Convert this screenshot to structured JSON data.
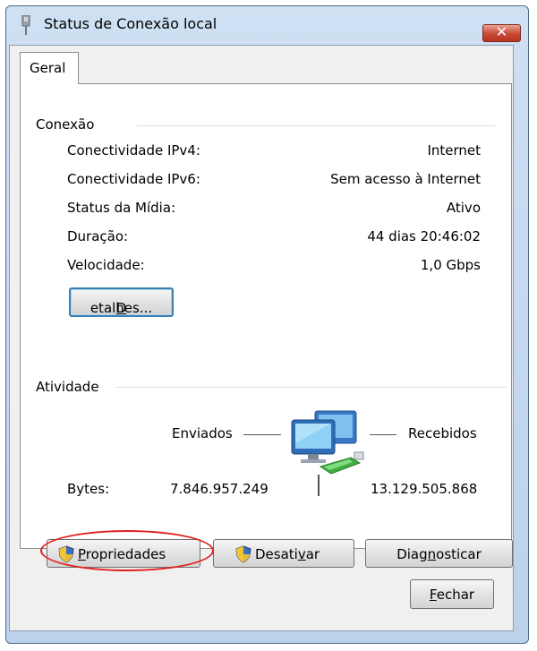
{
  "window": {
    "title": "Status de Conexão local",
    "close_label": "✕"
  },
  "tab": {
    "label": "Geral"
  },
  "connection": {
    "group_label": "Conexão",
    "rows": [
      {
        "label": "Conectividade IPv4:",
        "value": "Internet"
      },
      {
        "label": "Conectividade IPv6:",
        "value": "Sem acesso à Internet"
      },
      {
        "label": "Status da Mídia:",
        "value": "Ativo"
      },
      {
        "label": "Duração:",
        "value": "44 dias 20:46:02"
      },
      {
        "label": "Velocidade:",
        "value": "1,0 Gbps"
      }
    ],
    "details_button": {
      "mnemonic": "D",
      "rest": "etalhes..."
    }
  },
  "activity": {
    "group_label": "Atividade",
    "sent_label": "Enviados",
    "received_label": "Recebidos",
    "bytes_label": "Bytes:",
    "bytes_sent": "7.846.957.249",
    "bytes_received": "13.129.505.868"
  },
  "buttons": {
    "properties": {
      "mnemonic": "P",
      "rest": "ropriedades"
    },
    "disable": {
      "before": "Desati",
      "mnemonic": "v",
      "after": "ar"
    },
    "diagnose": {
      "before": "Diag",
      "mnemonic": "n",
      "after": "osticar"
    },
    "close": {
      "mnemonic": "F",
      "rest": "echar"
    }
  },
  "icons": {
    "title": "network-adapter-icon",
    "network": "network-computers-icon",
    "shield": "uac-shield-icon"
  },
  "colors": {
    "highlight_ellipse": "#e02020",
    "close_button": "#c94a38"
  }
}
